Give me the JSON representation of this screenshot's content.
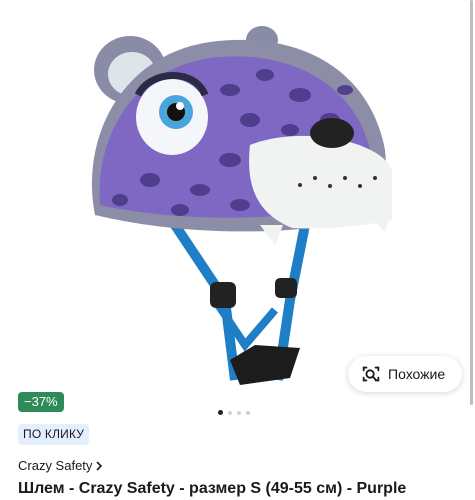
{
  "gallery": {
    "image_alt": "Purple leopard helmet",
    "slide_count": 4,
    "active_slide": 1,
    "similar_button": {
      "label": "Похожие",
      "icon": "camera-search-icon"
    }
  },
  "product": {
    "discount": "−37%",
    "promo": "ПО КЛИКУ",
    "brand": "Crazy Safety",
    "title": "Шлем - Crazy Safety - размер S (49-55 см) - Purple"
  },
  "colors": {
    "discount_bg": "#2e8b57",
    "promo_bg": "#e3efff",
    "helmet_purple": "#7b61c9",
    "strap_blue": "#1e7fc6"
  }
}
